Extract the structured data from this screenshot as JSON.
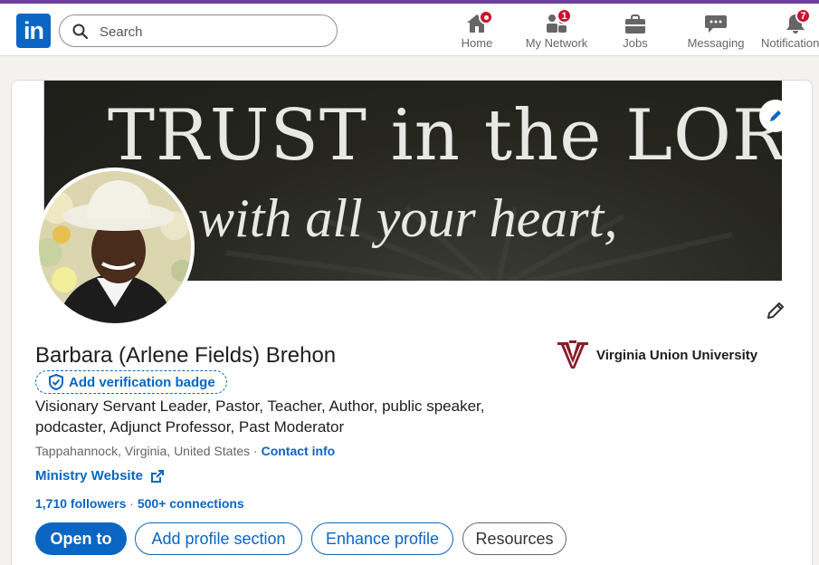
{
  "nav": {
    "search": {
      "placeholder": "Search"
    },
    "items": [
      {
        "label": "Home",
        "icon": "home-icon",
        "badge": ""
      },
      {
        "label": "My Network",
        "icon": "network-icon",
        "badge": "1"
      },
      {
        "label": "Jobs",
        "icon": "briefcase-icon",
        "badge": ""
      },
      {
        "label": "Messaging",
        "icon": "message-icon",
        "badge": ""
      },
      {
        "label": "Notifications",
        "icon": "bell-icon",
        "badge": "7"
      }
    ]
  },
  "banner": {
    "line1": "TRUST in the LORD",
    "line2": "with all your heart,"
  },
  "profile": {
    "name": "Barbara (Arlene Fields) Brehon",
    "verify_label": "Add verification badge",
    "headline": "Visionary Servant Leader, Pastor, Teacher, Author, public speaker, podcaster, Adjunct Professor, Past Moderator",
    "location": "Tappahannock, Virginia, United States",
    "location_sep": "·",
    "contact_label": "Contact info",
    "website_label": "Ministry Website",
    "followers": "1,710 followers",
    "connections": "500+ connections",
    "education": {
      "school": "Virginia Union University"
    }
  },
  "actions": {
    "open_to": "Open to",
    "add_section": "Add profile section",
    "enhance": "Enhance profile",
    "resources": "Resources"
  },
  "colors": {
    "brand": "#0a66c2",
    "badge": "#cb112d",
    "accent_stripe": "#6b3fa0",
    "school_logo": "#8b1a2b"
  }
}
